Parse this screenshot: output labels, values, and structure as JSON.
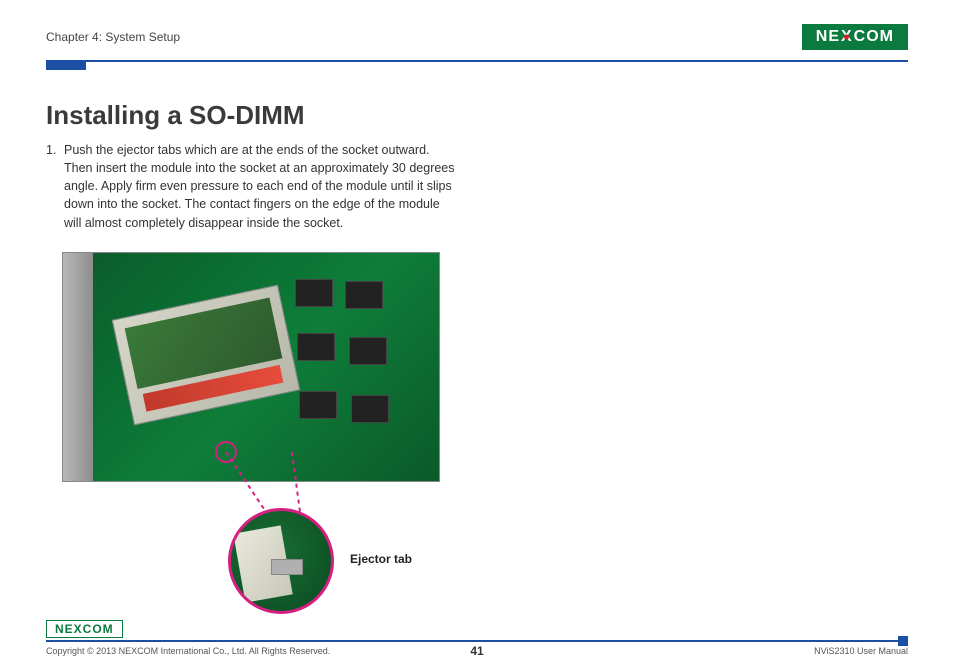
{
  "header": {
    "chapter": "Chapter 4: System Setup",
    "logo_text": "NEXCOM"
  },
  "content": {
    "heading": "Installing a SO-DIMM",
    "step_number": "1.",
    "step_text": "Push the ejector tabs which are at the ends of the socket outward. Then insert the module into the socket at an approximately 30 degrees angle. Apply firm even pressure to each end of the module until it slips down into the socket. The contact fingers on the edge of the module will almost completely disappear inside the socket.",
    "callout_label": "Ejector tab"
  },
  "footer": {
    "logo_text": "NEXCOM",
    "copyright": "Copyright © 2013 NEXCOM International Co., Ltd. All Rights Reserved.",
    "page_number": "41",
    "doc_title": "NViS2310 User Manual"
  }
}
